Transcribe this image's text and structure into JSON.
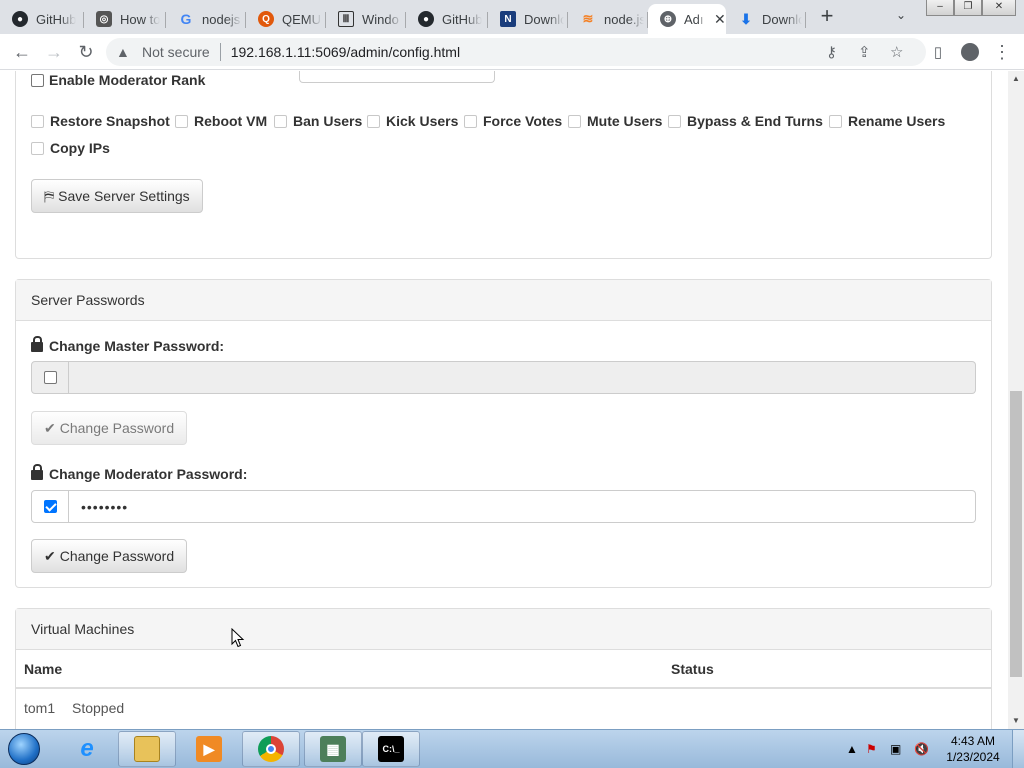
{
  "browser": {
    "tabs": [
      {
        "title": "GitHub",
        "icon": "github-icon",
        "active": false
      },
      {
        "title": "How to",
        "icon": "openstack-icon",
        "active": false
      },
      {
        "title": "nodejs",
        "icon": "google-icon",
        "active": false
      },
      {
        "title": "QEMU",
        "icon": "qemu-icon",
        "active": false
      },
      {
        "title": "Windo",
        "icon": "archive-icon",
        "active": false
      },
      {
        "title": "GitHub",
        "icon": "github-icon",
        "active": false
      },
      {
        "title": "Downlo",
        "icon": "notion-icon",
        "active": false
      },
      {
        "title": "node.js",
        "icon": "stackoverflow-icon",
        "active": false
      },
      {
        "title": "Adı",
        "icon": "globe-icon",
        "active": true
      },
      {
        "title": "Downlo",
        "icon": "download-icon",
        "active": false
      }
    ],
    "security_label": "Not secure",
    "url": "192.168.1.11:5069/admin/config.html"
  },
  "settings": {
    "enable_moderator_label": "Enable Moderator Rank",
    "permissions": [
      {
        "label": "Restore Snapshot",
        "checked": false
      },
      {
        "label": "Reboot VM",
        "checked": false
      },
      {
        "label": "Ban Users",
        "checked": false
      },
      {
        "label": "Kick Users",
        "checked": false
      },
      {
        "label": "Force Votes",
        "checked": false
      },
      {
        "label": "Mute Users",
        "checked": false
      },
      {
        "label": "Bypass & End Turns",
        "checked": false
      },
      {
        "label": "Rename Users",
        "checked": false
      },
      {
        "label": "Copy IPs",
        "checked": false
      }
    ],
    "save_label": "Save Server Settings"
  },
  "passwords": {
    "heading": "Server Passwords",
    "master_label": "Change Master Password:",
    "master_value": "",
    "master_checked": false,
    "master_button": "Change Password",
    "moderator_label": "Change Moderator Password:",
    "moderator_value": "••••••••",
    "moderator_checked": true,
    "moderator_button": "Change Password"
  },
  "vms": {
    "heading": "Virtual Machines",
    "columns": [
      "Name",
      "Status"
    ],
    "rows": [
      {
        "name": "tom1",
        "status": "Stopped"
      }
    ]
  },
  "taskbar": {
    "time": "4:43 AM",
    "date": "1/23/2024"
  }
}
